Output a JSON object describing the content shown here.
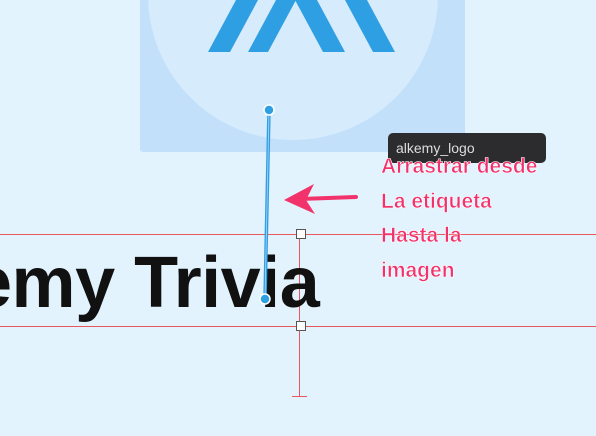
{
  "image_view": {
    "logo_icon": "logo-chevrons-icon",
    "accent": "#2f9fe4"
  },
  "tooltip": {
    "text": "alkemy_logo"
  },
  "canvas": {
    "title_text": "emy Trivia"
  },
  "annotation": {
    "color": "#f2336b",
    "lines": [
      "Arrastrar desde",
      "La etiqueta",
      "Hasta la",
      "imagen"
    ]
  },
  "colors": {
    "background": "#e2f3fd",
    "guide": "#e8575c",
    "connector": "#2f9fe4"
  }
}
